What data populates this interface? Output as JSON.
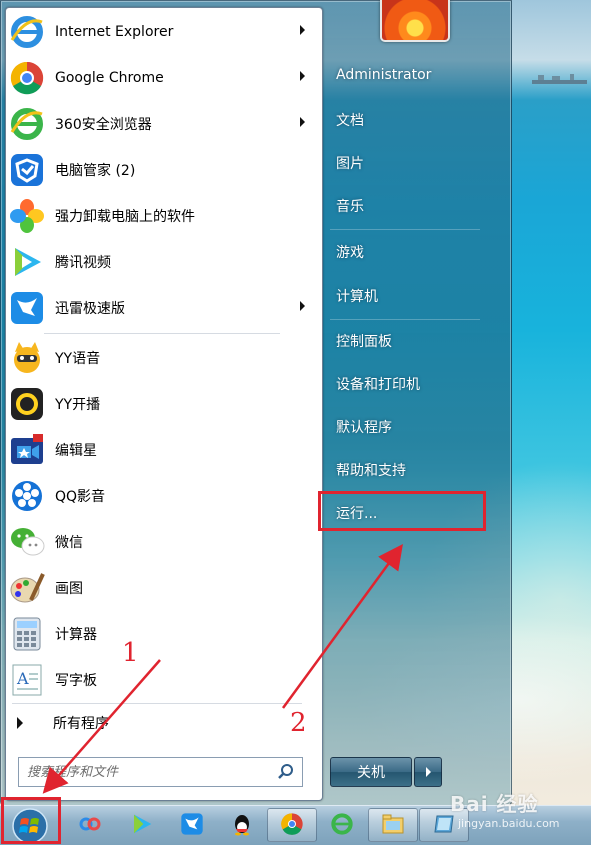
{
  "start_menu": {
    "programs": [
      {
        "label": "Internet Explorer",
        "icon": "ie-icon",
        "has_submenu": true
      },
      {
        "label": "Google Chrome",
        "icon": "chrome-icon",
        "has_submenu": true
      },
      {
        "label": "360安全浏览器",
        "icon": "360-browser-icon",
        "has_submenu": true
      },
      {
        "label": "电脑管家 (2)",
        "icon": "pc-manager-icon",
        "has_submenu": false
      },
      {
        "label": "强力卸载电脑上的软件",
        "icon": "uninstaller-icon",
        "has_submenu": false
      },
      {
        "label": "腾讯视频",
        "icon": "tencent-video-icon",
        "has_submenu": false
      },
      {
        "label": "迅雷极速版",
        "icon": "xunlei-icon",
        "has_submenu": true
      },
      {
        "label": "YY语音",
        "icon": "yy-voice-icon",
        "has_submenu": false
      },
      {
        "label": "YY开播",
        "icon": "yy-live-icon",
        "has_submenu": false
      },
      {
        "label": "编辑星",
        "icon": "editor-star-icon",
        "has_submenu": false
      },
      {
        "label": "QQ影音",
        "icon": "qq-player-icon",
        "has_submenu": false
      },
      {
        "label": "微信",
        "icon": "wechat-icon",
        "has_submenu": false
      },
      {
        "label": "画图",
        "icon": "paint-icon",
        "has_submenu": false
      },
      {
        "label": "计算器",
        "icon": "calculator-icon",
        "has_submenu": false
      },
      {
        "label": "写字板",
        "icon": "wordpad-icon",
        "has_submenu": false
      }
    ],
    "all_programs": "所有程序",
    "search_placeholder": "搜索程序和文件",
    "right_items": [
      "Administrator",
      "文档",
      "图片",
      "音乐",
      "游戏",
      "计算机",
      "控制面板",
      "设备和打印机",
      "默认程序",
      "帮助和支持",
      "运行..."
    ],
    "shutdown_label": "关机"
  },
  "annotations": {
    "step1": "1",
    "step2": "2",
    "color": "#e0242f"
  },
  "watermark": {
    "brand": "Bai 经验",
    "url": "jingyan.baidu.com"
  },
  "taskbar": {
    "items": [
      "start-orb-icon",
      "baidu-netdisk-icon",
      "tencent-video-icon",
      "xunlei-icon",
      "qq-icon",
      "chrome-icon",
      "360-browser-icon",
      "file-explorer-icon",
      "desktop-icon"
    ]
  }
}
